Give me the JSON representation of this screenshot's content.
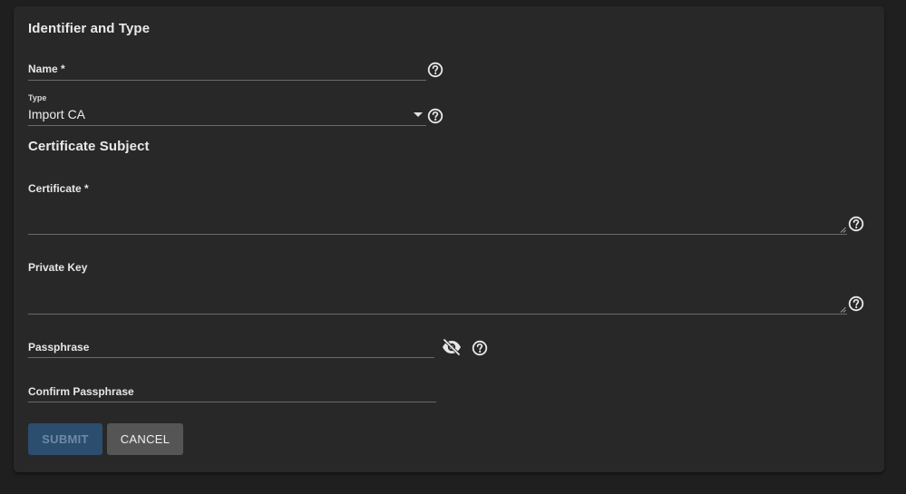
{
  "sections": {
    "identifier_title": "Identifier and Type",
    "subject_title": "Certificate Subject"
  },
  "fields": {
    "name": {
      "label": "Name *",
      "value": ""
    },
    "type": {
      "label": "Type",
      "value": "Import CA"
    },
    "certificate": {
      "label": "Certificate *",
      "value": ""
    },
    "private_key": {
      "label": "Private Key",
      "value": ""
    },
    "passphrase": {
      "label": "Passphrase",
      "value": ""
    },
    "confirm_passphrase": {
      "label": "Confirm Passphrase",
      "value": ""
    }
  },
  "buttons": {
    "submit": "SUBMIT",
    "cancel": "CANCEL"
  },
  "icons": {
    "help": "help-circle-icon",
    "visibility": "eye-off-icon",
    "dropdown": "caret-down-icon"
  },
  "colors": {
    "background": "#1f1f1f",
    "card": "#282828",
    "submit_bg": "#2b4d6e",
    "cancel_bg": "#555555"
  }
}
